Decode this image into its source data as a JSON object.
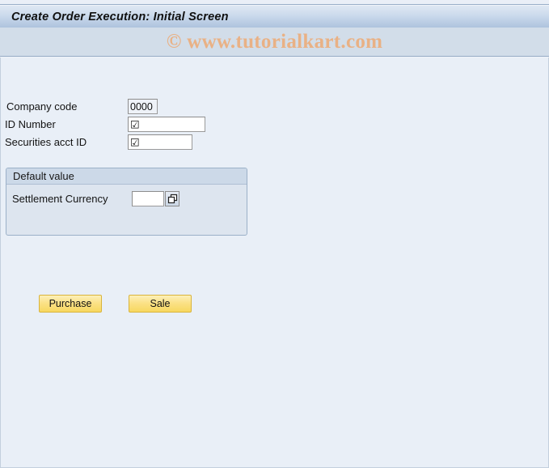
{
  "window": {
    "title": "Create Order Execution: Initial Screen"
  },
  "watermark": {
    "text": "© www.tutorialkart.com",
    "color": "#e9b185"
  },
  "form": {
    "fields": [
      {
        "label": "Company code",
        "value": "0000",
        "placeholder": "",
        "glyph": ""
      },
      {
        "label": "ID Number",
        "value": "",
        "placeholder": "",
        "glyph": "☑"
      },
      {
        "label": "Securities acct ID",
        "value": "",
        "placeholder": "",
        "glyph": "☑"
      }
    ]
  },
  "group_box": {
    "title": "Default value",
    "field": {
      "label": "Settlement Currency",
      "value": "",
      "placeholder": "",
      "value_help_icon": "value-help-icon"
    }
  },
  "buttons": {
    "purchase": "Purchase",
    "sale": "Sale"
  },
  "colors": {
    "title_bar_accent": "#aec3de",
    "content_background": "#e9eff7",
    "button_accent": "#fbe185",
    "group_border": "#9bb0c8"
  }
}
